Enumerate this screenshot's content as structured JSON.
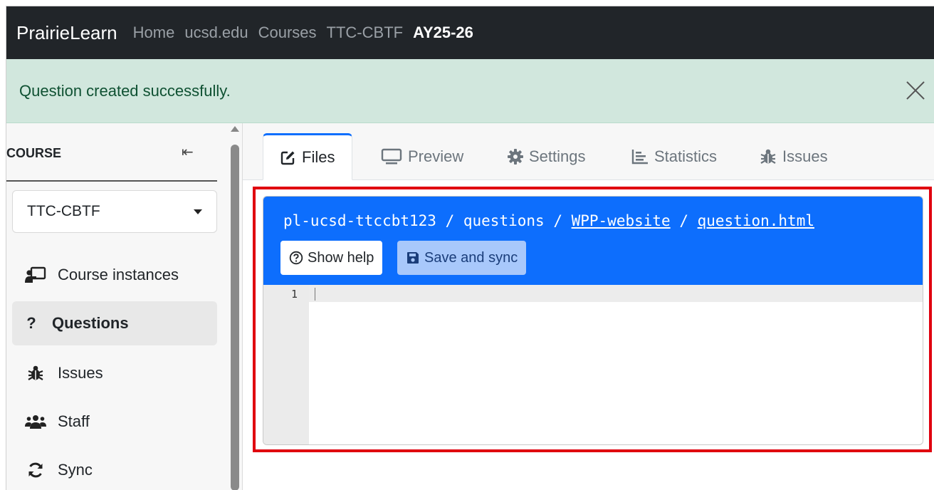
{
  "navbar": {
    "brand": "PrairieLearn",
    "breadcrumbs": [
      "Home",
      "ucsd.edu",
      "Courses",
      "TTC-CBTF",
      "AY25-26"
    ]
  },
  "alert": {
    "message": "Question created successfully.",
    "close_icon": "close-icon"
  },
  "sidebar": {
    "heading": "COURSE",
    "collapse_glyph": "⇤",
    "selected_course": "TTC-CBTF",
    "items": [
      {
        "label": "Course instances",
        "icon": "chalkboard-teacher-icon"
      },
      {
        "label": "Questions",
        "icon": "question-icon",
        "glyph": "?",
        "active": true
      },
      {
        "label": "Issues",
        "icon": "bug-icon"
      },
      {
        "label": "Staff",
        "icon": "users-icon"
      },
      {
        "label": "Sync",
        "icon": "sync-icon"
      }
    ]
  },
  "tabs": [
    {
      "label": "Files",
      "icon": "edit-icon",
      "active": true
    },
    {
      "label": "Preview",
      "icon": "desktop-icon"
    },
    {
      "label": "Settings",
      "icon": "gear-icon"
    },
    {
      "label": "Statistics",
      "icon": "chart-bar-icon"
    },
    {
      "label": "Issues",
      "icon": "bug-icon"
    }
  ],
  "editor": {
    "path_root": "pl-ucsd-ttccbt123",
    "path_sep": " / ",
    "path_folder": "questions",
    "path_question": "WPP-website",
    "path_file": "question.html",
    "show_help_label": "Show help",
    "save_label": "Save and sync",
    "line_numbers": [
      "1"
    ],
    "header_color": "#0d6efd"
  },
  "colors": {
    "navbar": "#212529",
    "alert_bg": "#d1e7dd",
    "alert_text": "#0f5132",
    "highlight_border": "#e0000f"
  }
}
